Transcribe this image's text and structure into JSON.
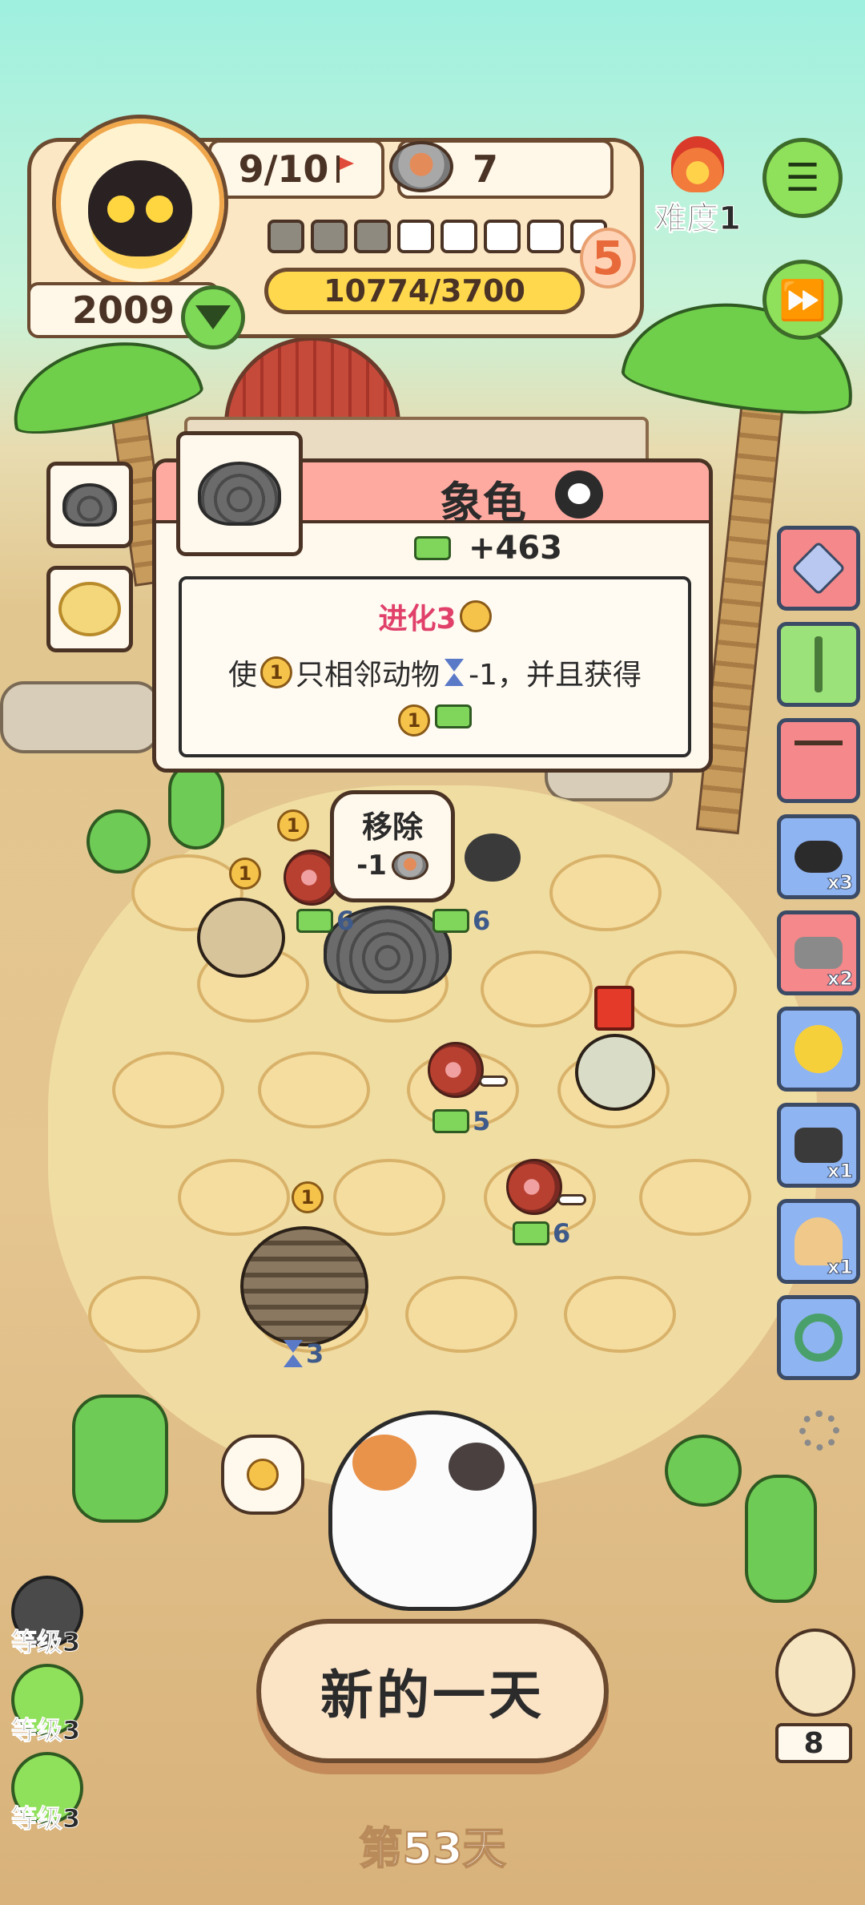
{
  "hud": {
    "collection": "9/10",
    "food_cans": "7",
    "coins": "2009",
    "xp": "10774/3700",
    "level": "5",
    "pips_filled": 3,
    "pips_total": 8,
    "difficulty": "难度1"
  },
  "popup": {
    "title": "象龟",
    "income": "+463",
    "evolution": "进化3",
    "description": "使",
    "description_count": "1",
    "description_rest": "只相邻动物",
    "description_end": "-1，并且获得",
    "reward_coin": "1"
  },
  "remove": {
    "label": "移除",
    "cost": "-1"
  },
  "board": {
    "tags": [
      "6",
      "6",
      "5",
      "6",
      "3"
    ],
    "coin_badges": [
      "1",
      "1",
      "1",
      "1"
    ]
  },
  "items": [
    {
      "name": "crystal-icon",
      "count": ""
    },
    {
      "name": "caduceus-icon",
      "count": ""
    },
    {
      "name": "meat-rack-icon",
      "count": ""
    },
    {
      "name": "binoculars-icon",
      "count": "x3"
    },
    {
      "name": "egg-tray-icon",
      "count": "x2"
    },
    {
      "name": "rubber-duck-icon",
      "count": ""
    },
    {
      "name": "radio-icon",
      "count": "x1"
    },
    {
      "name": "candle-cake-icon",
      "count": "x1"
    },
    {
      "name": "ring-icon",
      "count": ""
    }
  ],
  "levels": [
    {
      "label": "等级3",
      "color": "#4a4a4a"
    },
    {
      "label": "等级3",
      "color": "#8fe05a"
    },
    {
      "label": "等级3",
      "color": "#8fe05a"
    }
  ],
  "owl_count": "8",
  "new_day": "新的一天",
  "day": "第53天",
  "colors": {
    "popup_header": "#ffaaa0",
    "evolution_text": "#e0406a",
    "accent_green": "#8fe05a"
  }
}
